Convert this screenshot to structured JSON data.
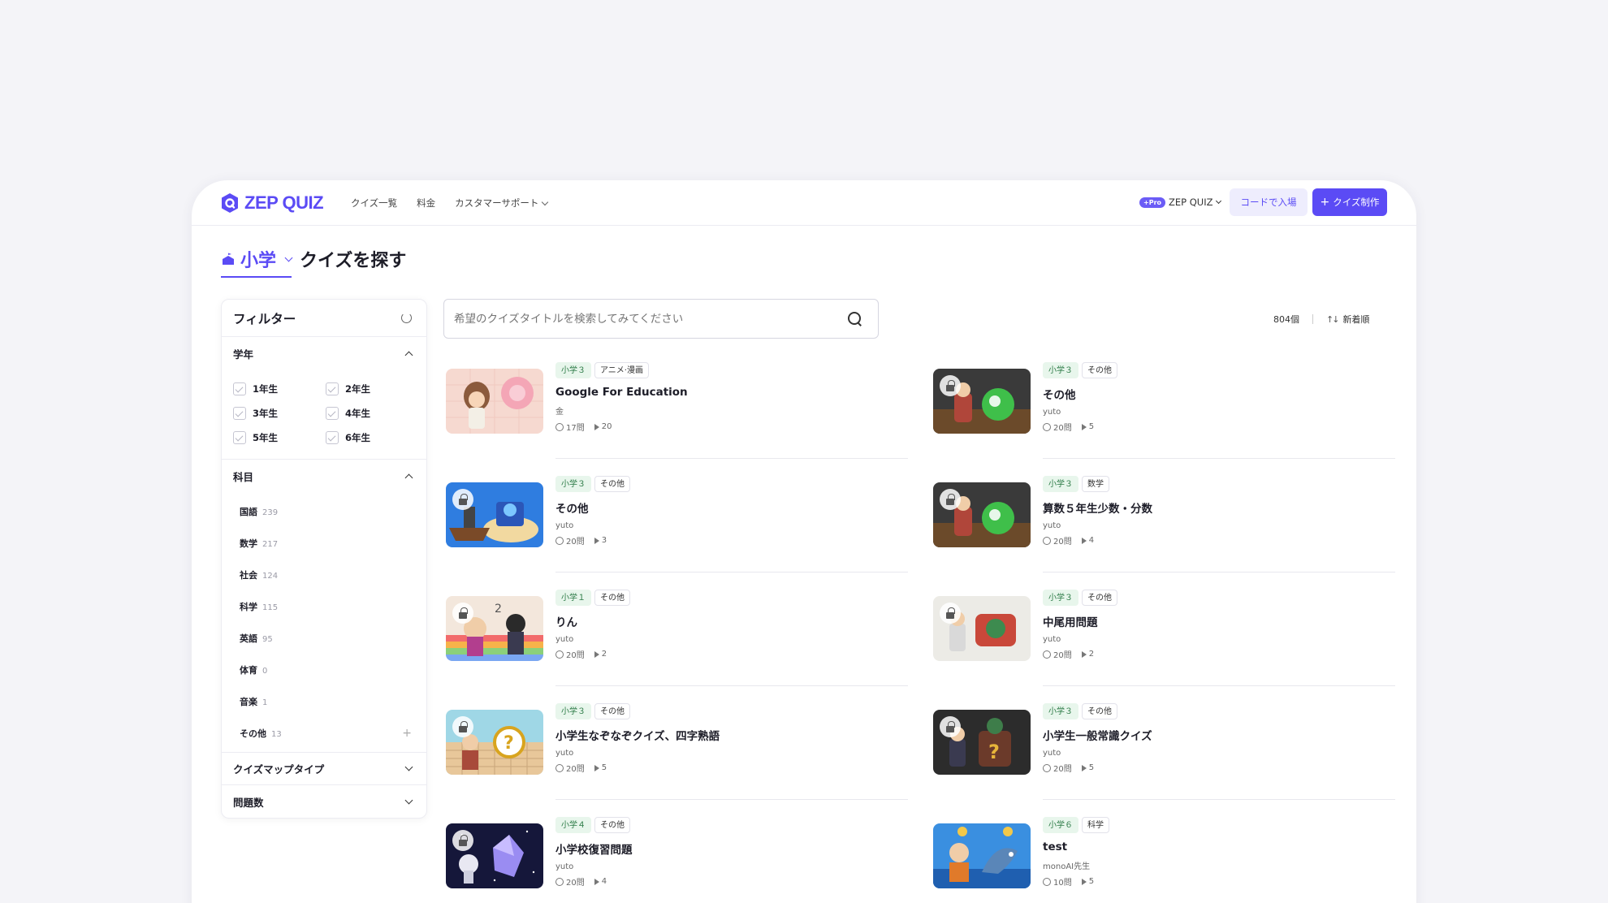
{
  "header": {
    "logo": "ZEP QUIZ",
    "nav": [
      "クイズ一覧",
      "料金",
      "カスタマーサポート"
    ],
    "pro_badge": "+Pro",
    "pro_label": "ZEP QUIZ",
    "code_button": "コードで入場",
    "make_button": "クイズ制作"
  },
  "page": {
    "grade": "小学",
    "title": "クイズを探す"
  },
  "filter": {
    "title": "フィルター",
    "grade_section": "学年",
    "grades": [
      "1年生",
      "2年生",
      "3年生",
      "4年生",
      "5年生",
      "6年生"
    ],
    "subject_section": "科目",
    "subjects": [
      {
        "name": "国語",
        "count": "239"
      },
      {
        "name": "数学",
        "count": "217"
      },
      {
        "name": "社会",
        "count": "124"
      },
      {
        "name": "科学",
        "count": "115"
      },
      {
        "name": "英語",
        "count": "95"
      },
      {
        "name": "体育",
        "count": "0"
      },
      {
        "name": "音楽",
        "count": "1"
      },
      {
        "name": "その他",
        "count": "13"
      }
    ],
    "map_type_section": "クイズマップタイプ",
    "question_count_section": "問題数"
  },
  "search": {
    "placeholder": "希望のクイズタイトルを検索してみてください"
  },
  "results": {
    "count": "804個",
    "sort": "新着順"
  },
  "cards": [
    {
      "grade": "小学３",
      "category": "アニメ·漫画",
      "title": "Google For Education",
      "author": "金",
      "questions": "17問",
      "plays": "20"
    },
    {
      "grade": "小学３",
      "category": "その他",
      "title": "その他",
      "author": "yuto",
      "questions": "20問",
      "plays": "5"
    },
    {
      "grade": "小学３",
      "category": "その他",
      "title": "その他",
      "author": "yuto",
      "questions": "20問",
      "plays": "3"
    },
    {
      "grade": "小学３",
      "category": "数学",
      "title": "算数５年生少数・分数",
      "author": "yuto",
      "questions": "20問",
      "plays": "4"
    },
    {
      "grade": "小学１",
      "category": "その他",
      "title": "りん",
      "author": "yuto",
      "questions": "20問",
      "plays": "2"
    },
    {
      "grade": "小学３",
      "category": "その他",
      "title": "中尾用問題",
      "author": "yuto",
      "questions": "20問",
      "plays": "2"
    },
    {
      "grade": "小学３",
      "category": "その他",
      "title": "小学生なぞなぞクイズ、四字熟語",
      "author": "yuto",
      "questions": "20問",
      "plays": "5"
    },
    {
      "grade": "小学３",
      "category": "その他",
      "title": "小学生一般常識クイズ",
      "author": "yuto",
      "questions": "20問",
      "plays": "5"
    },
    {
      "grade": "小学４",
      "category": "その他",
      "title": "小学校復習問題",
      "author": "yuto",
      "questions": "20問",
      "plays": "4"
    },
    {
      "grade": "小学６",
      "category": "科学",
      "title": "test",
      "author": "monoAI先生",
      "questions": "10問",
      "plays": "5"
    }
  ]
}
